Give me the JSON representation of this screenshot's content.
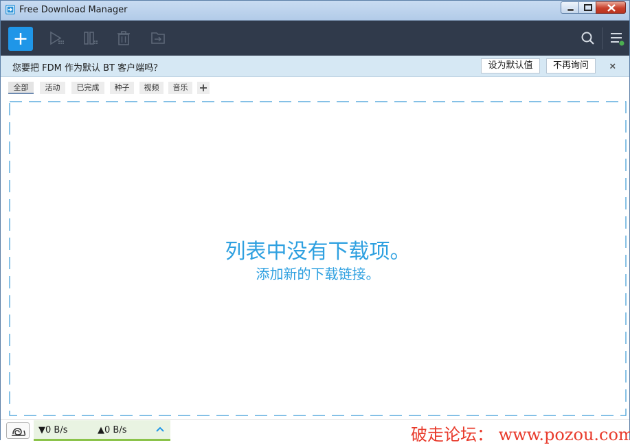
{
  "window": {
    "title": "Free Download Manager",
    "accent_color": "#1f96e8",
    "toolbar_bg": "#303a4b"
  },
  "toolbar": {
    "add_icon": "plus-icon",
    "start_icon": "play-icon",
    "pause_icon": "pause-icon",
    "delete_icon": "trash-icon",
    "move_icon": "folder-move-icon",
    "search_icon": "search-icon",
    "menu_icon": "hamburger-menu-icon",
    "status_dot_color": "#4caf50"
  },
  "notification": {
    "message": "您要把 FDM 作为默认 BT 客户端吗？",
    "set_default_label": "设为默认值",
    "dont_ask_label": "不再询问"
  },
  "filters": {
    "tabs": [
      {
        "label": "全部",
        "active": true
      },
      {
        "label": "活动",
        "active": false
      },
      {
        "label": "已完成",
        "active": false
      },
      {
        "label": "种子",
        "active": false
      },
      {
        "label": "视频",
        "active": false
      },
      {
        "label": "音乐",
        "active": false
      }
    ]
  },
  "empty_state": {
    "title": "列表中没有下载项。",
    "subtitle": "添加新的下载链接。"
  },
  "statusbar": {
    "download_speed": "0 B/s",
    "upload_speed": "0 B/s",
    "download_arrow": "▼",
    "upload_arrow": "▲",
    "watermark": "破走论坛： www.pozou.com"
  }
}
